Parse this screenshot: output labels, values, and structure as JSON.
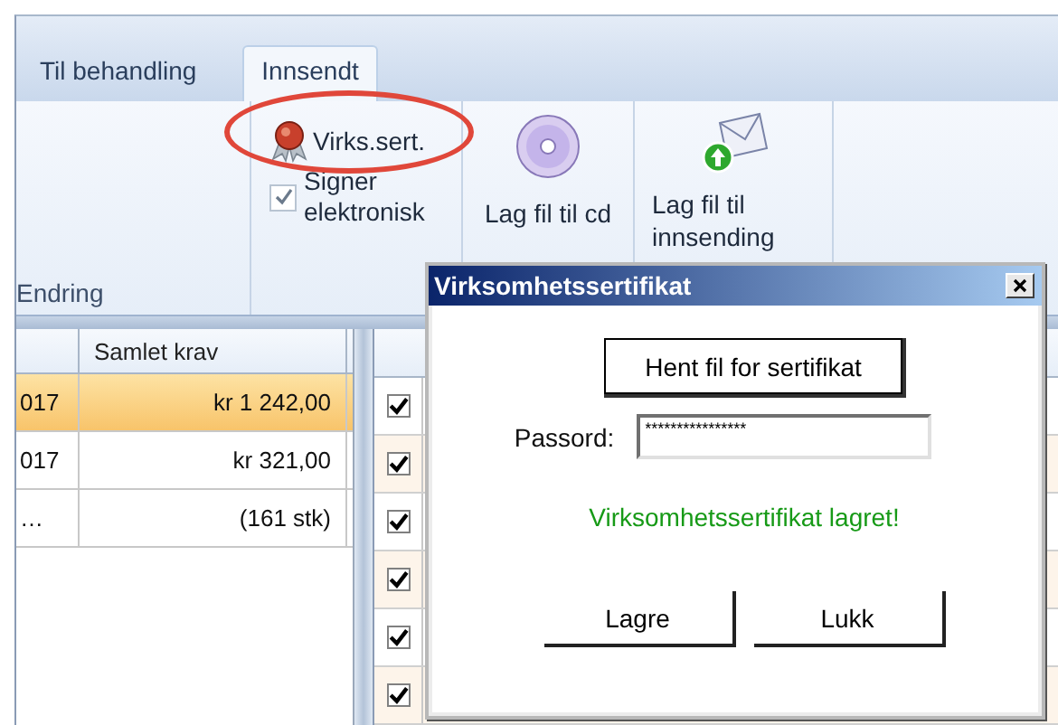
{
  "tabs": [
    {
      "label": "Til behandling",
      "selected": false
    },
    {
      "label": "Innsendt",
      "selected": true
    }
  ],
  "ribbon": {
    "group_label": "Endring",
    "cert_button": {
      "label": "Virks.sert.",
      "highlighted": true
    },
    "sign_checkbox": {
      "label": "Signer elektronisk",
      "checked": true
    },
    "cd_button": {
      "label": "Lag fil til cd"
    },
    "send_button": {
      "label": "Lag fil til innsending"
    }
  },
  "left_table": {
    "columns": [
      "Samlet krav"
    ],
    "rows": [
      {
        "column_1": "017",
        "samlet_krav": "kr 1 242,00",
        "selected": true
      },
      {
        "column_1": "017",
        "samlet_krav": "kr 321,00",
        "selected": false
      },
      {
        "column_1": "…",
        "samlet_krav": "(161 stk)",
        "selected": false
      }
    ]
  },
  "right_table": {
    "rows": [
      {
        "checked": true
      },
      {
        "checked": true
      },
      {
        "checked": true
      },
      {
        "checked": true
      },
      {
        "checked": true
      },
      {
        "checked": true
      }
    ]
  },
  "dialog": {
    "title": "Virksomhetssertifikat",
    "fetch_button": "Hent fil for sertifikat",
    "password_label": "Passord:",
    "password_value": "****************",
    "message": "Virksomhetssertifikat lagret!",
    "buttons": [
      "Lagre",
      "Lukk"
    ]
  }
}
